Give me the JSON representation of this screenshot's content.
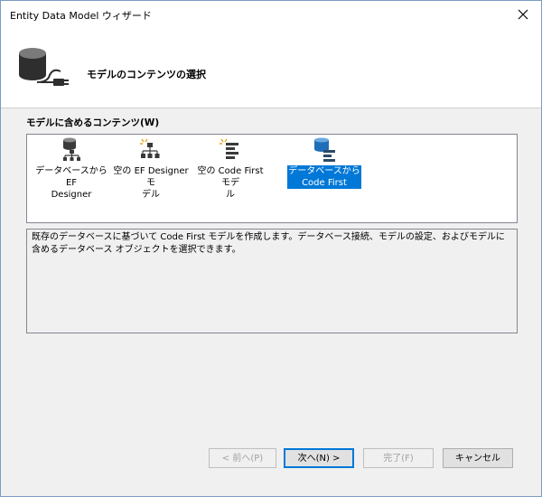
{
  "window": {
    "title": "Entity Data Model ウィザード",
    "close_icon": "close-icon"
  },
  "header": {
    "title": "モデルのコンテンツの選択",
    "icon": "database-plug-icon"
  },
  "content": {
    "label": "モデルに含めるコンテンツ(W)",
    "items": [
      {
        "label_line1": "データベースから EF",
        "label_line2": "Designer",
        "icon": "database-hierarchy-icon",
        "selected": false
      },
      {
        "label_line1": "空の EF Designer モ",
        "label_line2": "デル",
        "icon": "empty-hierarchy-icon",
        "selected": false
      },
      {
        "label_line1": "空の Code First モデ",
        "label_line2": "ル",
        "icon": "code-first-icon",
        "selected": false
      },
      {
        "label_line1": "データベースから",
        "label_line2": "Code First",
        "icon": "database-code-first-icon",
        "selected": true
      }
    ]
  },
  "description": {
    "text": "既存のデータベースに基づいて Code First モデルを作成します。データベース接続、モデルの設定、およびモデルに含めるデータベース オブジェクトを選択できます。"
  },
  "buttons": {
    "back": "< 前へ(P)",
    "next": "次へ(N) >",
    "finish": "完了(F)",
    "cancel": "キャンセル"
  },
  "colors": {
    "selection": "#0078d7",
    "desktop": "#5b86b2",
    "dialog_bg": "#f0f0f0"
  }
}
